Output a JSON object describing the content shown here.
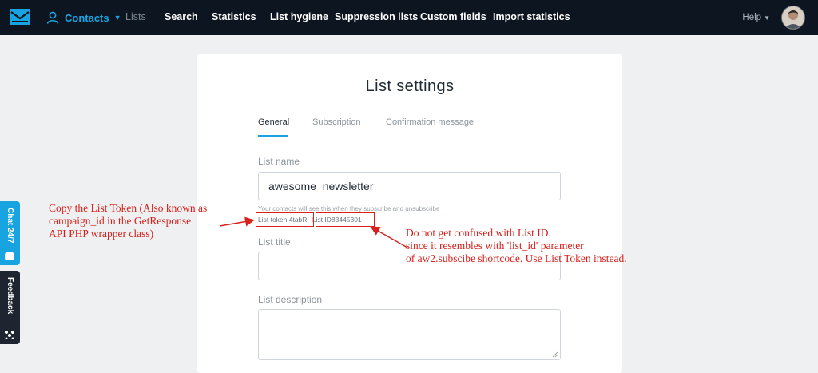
{
  "nav": {
    "contacts": "Contacts",
    "items": [
      "Lists",
      "Search",
      "Statistics",
      "List hygiene",
      "Suppression lists",
      "Custom fields",
      "Import statistics"
    ],
    "help": "Help"
  },
  "side": {
    "chat": "Chat 24/7",
    "feedback": "Feedback"
  },
  "card": {
    "title": "List settings",
    "tabs": [
      "General",
      "Subscription",
      "Confirmation message"
    ],
    "list_name_label": "List name",
    "list_name_value": "awesome_newsletter",
    "help_text": "Your contacts will see this when they subscribe and unsubscribe",
    "list_token": "List token:4tabR",
    "list_id": "List ID83445301",
    "list_title_label": "List title",
    "list_title_value": "",
    "list_description_label": "List description",
    "list_description_value": ""
  },
  "annotations": {
    "left": [
      "Copy the List Token (Also known as",
      "campaign_id in the GetResponse",
      "API PHP wrapper class)"
    ],
    "right": [
      "Do not get confused with List ID.",
      "since it resembles with 'list_id' parameter",
      "of aw2.subscibe shortcode. Use List Token instead."
    ]
  },
  "colors": {
    "accent": "#18a4e0",
    "topbar": "#0d1520",
    "annotation": "#d9201b"
  },
  "icons": [
    "envelope-logo-icon",
    "person-icon",
    "chevron-down-icon",
    "chat-bubble-icon",
    "feedback-dots-icon",
    "resize-handle-icon"
  ]
}
